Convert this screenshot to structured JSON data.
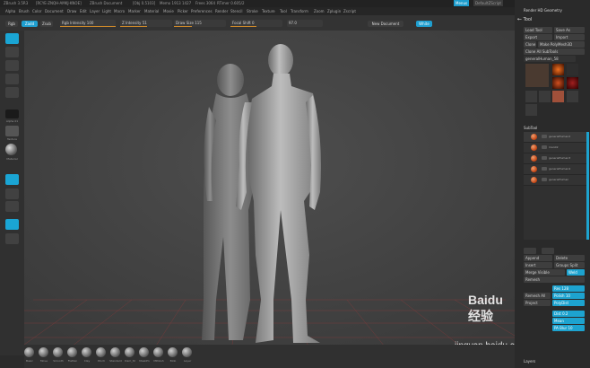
{
  "title_bar": {
    "items": [
      "ZBrush 3.5R3",
      "[RCYE-ZNQH-AMKJ-KNOE]",
      "ZBrush Document",
      "[Obj 0.5103]",
      "Memo 1913 1427",
      "Frees 3064",
      "RTimer 0.605/2"
    ],
    "menu_button": "Menus",
    "script_button": "DefaultZScript"
  },
  "menu_bar": {
    "items": [
      "Alpha",
      "Brush",
      "Color",
      "Document",
      "Draw",
      "Edit",
      "Layer",
      "Light",
      "Macro",
      "Marker",
      "Material",
      "Movie",
      "Picker",
      "Preferences",
      "Render",
      "Stencil",
      "Stroke",
      "Texture",
      "Tool",
      "Transform",
      "Zoom",
      "Zplugin",
      "Zscript"
    ]
  },
  "toolbar": {
    "rgb_label": "Rgb",
    "zadd_label": "Zadd",
    "zsub_label": "Zsub",
    "rgb_intensity": "Rgb Intensity 100",
    "z_intensity": "Z Intensity 51",
    "draw_size": "Draw Size 115",
    "focal_shift": "Focal Shift 0",
    "mrgb_value": "97.0",
    "new_document": "New Document",
    "white": "White"
  },
  "left_shelf": {
    "labels": [
      "Alpha 01",
      "Texture",
      "Material",
      "Sdiv",
      "Frame",
      "Move",
      "Scale",
      "Rotate",
      "Linear",
      "Floor",
      "Local",
      "Xpose"
    ]
  },
  "bottom_shelf": {
    "brushes": [
      "Basic",
      "Move",
      "Smooth",
      "Flatten",
      "Clay",
      "Pinch",
      "Standard",
      "Dam_St",
      "MaskPn",
      "MPolish",
      "Blob",
      "Layer"
    ]
  },
  "right_panel": {
    "header": "Render HD Geometry",
    "tool_title": "Tool",
    "load_tool": "Load Tool",
    "save_as": "Save As",
    "export": "Export",
    "import": "Import",
    "clone": "Clone",
    "make_polymesh": "Make PolyMesh3D",
    "clone_all": "Clone All SubTools",
    "current_tool": "generalHuman_58",
    "tool_count": "58",
    "subtool_title": "SubTool",
    "subtools": [
      "generalHuman2",
      "man02",
      "generalHuman3",
      "generalHuman4",
      "generalHuman"
    ],
    "list_all": "List All",
    "append": "Append",
    "delete": "Delete",
    "insert": "Insert",
    "groups_split": "Groups Split",
    "merge_visible": "Merge Visible",
    "weld": "Weld",
    "remesh": "Remesh",
    "res": "Res 128",
    "remesh_all": "Remesh All",
    "polish": "Polish 10",
    "project": "Project",
    "polydist": "PolyDist",
    "dist": "Dist 0.2",
    "mean": "Mean",
    "pa_blur": "PA Blur 10",
    "layers_title": "Layers"
  },
  "watermark": {
    "brand": "Baidu 经验",
    "url": "jingyan.baidu.com"
  }
}
